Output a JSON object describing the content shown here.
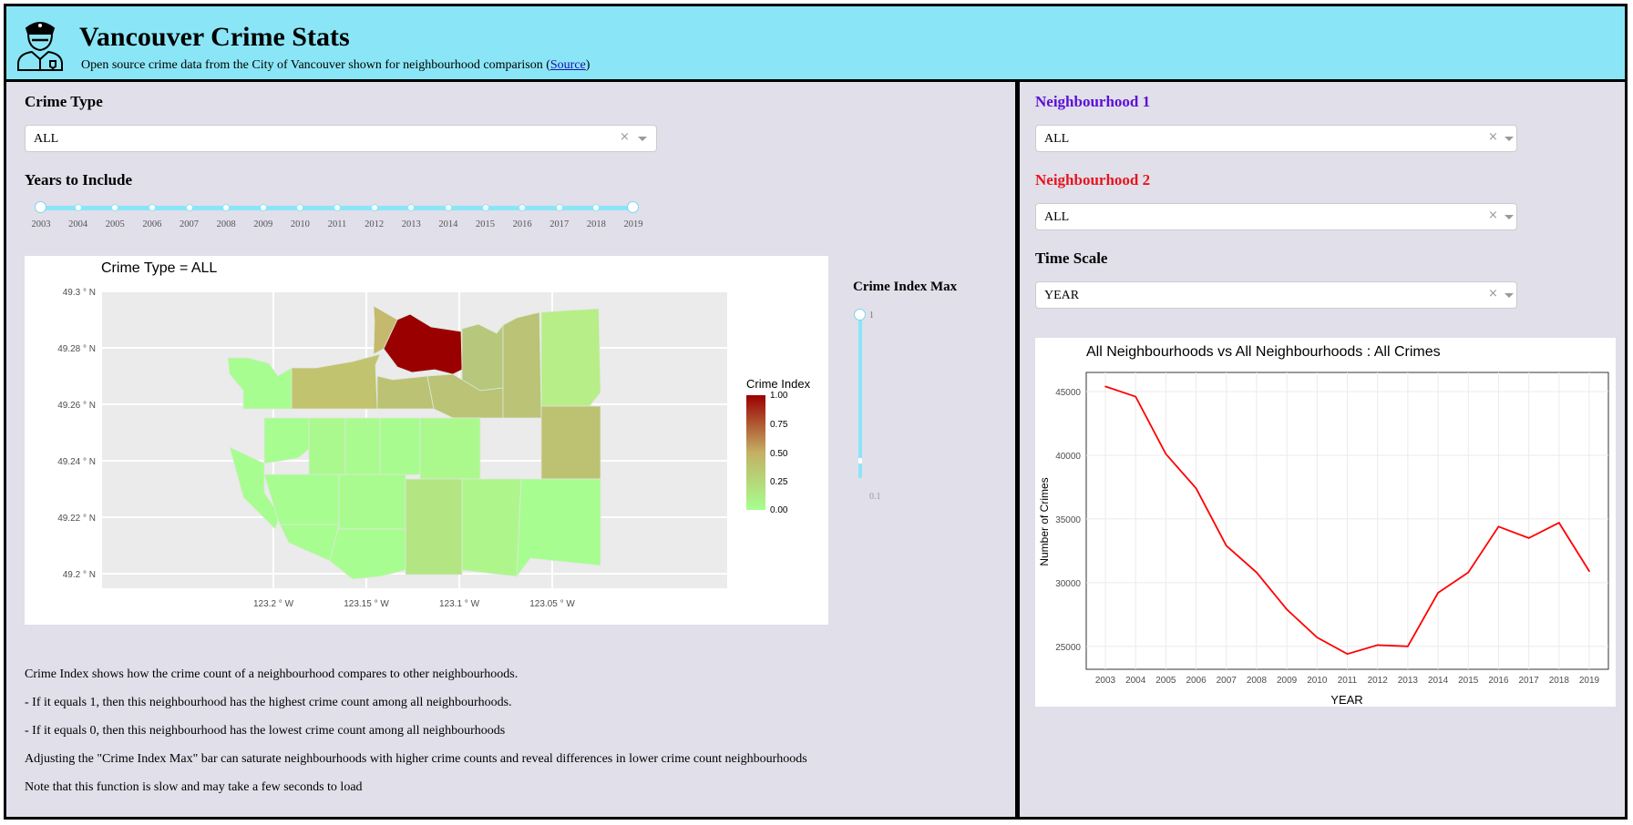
{
  "header": {
    "title": "Vancouver Crime Stats",
    "subtitle_before": "Open source crime data from the City of Vancouver shown for neighbourhood comparison (",
    "subtitle_link": "Source",
    "subtitle_after": ")",
    "logo_icon": "police-officer-icon",
    "bg_color": "#8ae6f6"
  },
  "left": {
    "crime_type_label": "Crime Type",
    "crime_type_value": "ALL",
    "years_label": "Years to Include",
    "years": [
      "2003",
      "2004",
      "2005",
      "2006",
      "2007",
      "2008",
      "2009",
      "2010",
      "2011",
      "2012",
      "2013",
      "2014",
      "2015",
      "2016",
      "2017",
      "2018",
      "2019"
    ],
    "year_range": [
      "2003",
      "2019"
    ],
    "map_title": "Crime Type = ALL",
    "lat_ticks": [
      "49.3 ° N",
      "49.28 ° N",
      "49.26 ° N",
      "49.24 ° N",
      "49.22 ° N",
      "49.2 ° N"
    ],
    "lon_ticks": [
      "123.2 ° W",
      "123.15 ° W",
      "123.1 ° W",
      "123.05 ° W"
    ],
    "legend_title": "Crime Index",
    "legend_ticks": [
      "1.00",
      "0.75",
      "0.50",
      "0.25",
      "0.00"
    ],
    "legend_colors": {
      "high": "#9b0000",
      "mid": "#c4b064",
      "low": "#a6ff8f"
    },
    "index_max_label": "Crime Index Max",
    "index_max_top": "1",
    "index_max_bottom": "0.1",
    "index_max_value": 1,
    "notes": [
      "Crime Index shows how the crime count of a neighbourhood compares to other neighbourhoods.",
      "- If it equals 1, then this neighbourhood has the highest crime count among all neighbourhoods.",
      "- If it equals 0, then this neighbourhood has the lowest crime count among all neighbourhoods",
      "Adjusting the \"Crime Index Max\" bar can saturate neighbourhoods with higher crime counts and reveal differences in lower crime count neighbourhoods",
      "Note that this function is slow and may take a few seconds to load"
    ]
  },
  "right": {
    "n1_label": "Neighbourhood 1",
    "n1_color": "#5b0fd6",
    "n1_value": "ALL",
    "n2_label": "Neighbourhood 2",
    "n2_color": "#e8141d",
    "n2_value": "ALL",
    "time_scale_label": "Time Scale",
    "time_scale_value": "YEAR"
  },
  "chart_data": {
    "type": "line",
    "title": "All Neighbourhoods vs All Neighbourhoods : All Crimes",
    "xlabel": "YEAR",
    "ylabel": "Number of Crimes",
    "categories": [
      "2003",
      "2004",
      "2005",
      "2006",
      "2007",
      "2008",
      "2009",
      "2010",
      "2011",
      "2012",
      "2013",
      "2014",
      "2015",
      "2016",
      "2017",
      "2018",
      "2019"
    ],
    "series": [
      {
        "color": "#ff0000",
        "values": [
          45400,
          44600,
          40100,
          37400,
          32900,
          30800,
          27900,
          25700,
          24400,
          25100,
          25000,
          29200,
          30800,
          34400,
          33500,
          34700,
          30900
        ]
      }
    ],
    "yticks": [
      25000,
      30000,
      35000,
      40000,
      45000
    ],
    "ylim": [
      23200,
      46500
    ],
    "grid": true
  }
}
